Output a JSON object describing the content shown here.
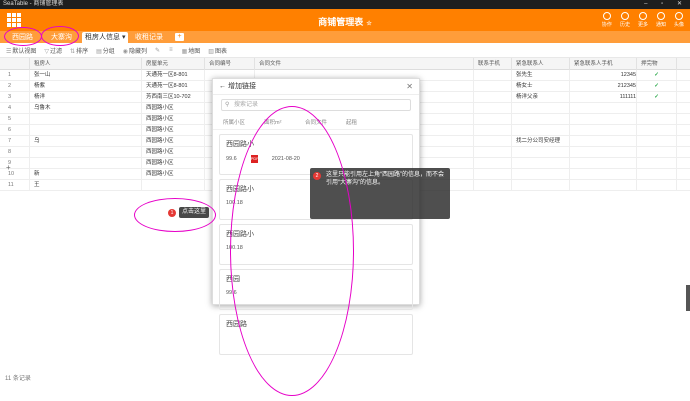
{
  "window": {
    "title": "SeaTable - 商铺管理表",
    "controls": "– ▫ ✕"
  },
  "app": {
    "title": "商铺管理表",
    "title_star": "☆",
    "tools": [
      "协作",
      "历史",
      "更多",
      "通知",
      "头像"
    ]
  },
  "tables": [
    {
      "label": "西园路"
    },
    {
      "label": "大寨沟"
    },
    {
      "label": "租房人信息"
    },
    {
      "label": "收租记录"
    }
  ],
  "toolbar": {
    "items": [
      "默认视图",
      "过滤",
      "排序",
      "分组",
      "隐藏列",
      "地图",
      "图表"
    ]
  },
  "columns": [
    "租房人",
    "房屋单元",
    "合同编号",
    "合同文件",
    "联系手机",
    "联系人",
    "紧急联系人",
    "紧急联系人手机",
    "押完物"
  ],
  "rows": [
    {
      "n": "1",
      "name": "张一山",
      "unit": "天通苑一区8-801",
      "contact": "张先生",
      "phone": "12345",
      "chk": "✓"
    },
    {
      "n": "2",
      "name": "杨紫",
      "unit": "天通苑一区8-801",
      "contact": "杨女士",
      "phone": "212345",
      "chk": "✓"
    },
    {
      "n": "3",
      "name": "杨洋",
      "unit": "芳西南三区10-702",
      "contact": "杨洋父亲",
      "phone": "111111",
      "chk": "✓"
    },
    {
      "n": "4",
      "name": "乌鲁木",
      "unit": "西园路小区",
      "contact": "",
      "phone": "",
      "chk": ""
    },
    {
      "n": "5",
      "name": "",
      "unit": "西园路小区",
      "contact": "",
      "phone": "",
      "chk": ""
    },
    {
      "n": "6",
      "name": "",
      "unit": "西园路小区",
      "contact": "",
      "phone": "",
      "chk": ""
    },
    {
      "n": "7",
      "name": "乌",
      "unit": "西园路小区",
      "contact": "找二分公司安经理",
      "phone": "",
      "chk": ""
    },
    {
      "n": "8",
      "name": "",
      "unit": "西园路小区",
      "contact": "",
      "phone": "",
      "chk": ""
    },
    {
      "n": "9",
      "name": "",
      "unit": "西园路小区",
      "contact": "",
      "phone": "",
      "chk": ""
    },
    {
      "n": "10",
      "name": "新",
      "unit": "西园路小区",
      "contact": "",
      "phone": "",
      "chk": ""
    },
    {
      "n": "11",
      "name": "王",
      "unit": "",
      "contact": "",
      "phone": "",
      "chk": ""
    }
  ],
  "modal": {
    "title": "增加链接",
    "search_placeholder": "搜索记录",
    "cols": [
      "所属小区",
      "面积m²",
      "合同文件",
      "起租"
    ],
    "records": [
      {
        "title": "西园路小",
        "area": "99.6",
        "date": "2021-08-20",
        "pdf": "PDF"
      },
      {
        "title": "西园路小",
        "area": "100.18",
        "date": "",
        "pdf": ""
      },
      {
        "title": "西园路小",
        "area": "100.18",
        "date": "",
        "pdf": ""
      },
      {
        "title": "西园",
        "area": "99.6",
        "date": "",
        "pdf": ""
      },
      {
        "title": "西园路",
        "area": "",
        "date": "",
        "pdf": ""
      }
    ]
  },
  "annotation": {
    "badge1": "1",
    "click_here": "点击这里",
    "badge2": "2",
    "tip": "这里只能引用左上角“西园路”的信息，而不会引用“大寨沟”的信息。"
  },
  "status": {
    "count": "11 条记录"
  },
  "accent": "#ff8000",
  "ring": "#e600c8"
}
